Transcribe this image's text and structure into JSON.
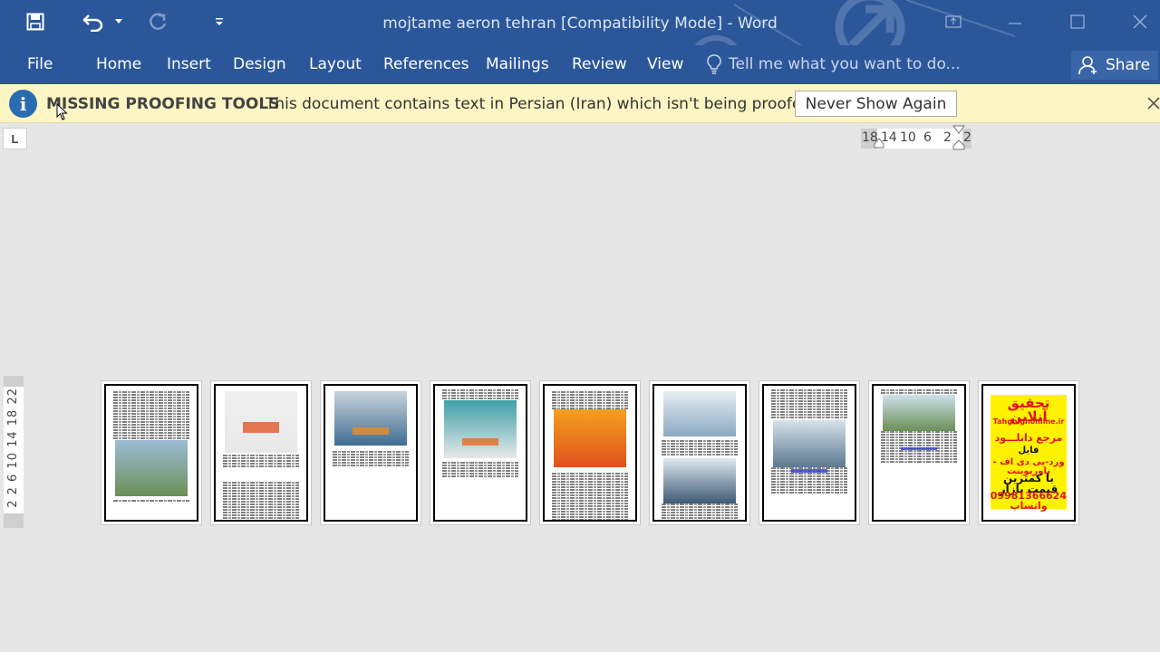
{
  "window": {
    "title": "mojtame aeron tehran [Compatibility Mode] - Word"
  },
  "ribbon": {
    "tabs": [
      "File",
      "Home",
      "Insert",
      "Design",
      "Layout",
      "References",
      "Mailings",
      "Review",
      "View"
    ],
    "tell_me_placeholder": "Tell me what you want to do...",
    "share_label": "Share"
  },
  "message_bar": {
    "title": "MISSING PROOFING TOOLS",
    "text": "This document contains text in Persian (Iran) which isn't being proofed.",
    "button_label": "Never Show Again"
  },
  "ruler": {
    "tab_selector": "L",
    "horizontal_numbers": [
      "18",
      "14",
      "10",
      "6",
      "2",
      "2"
    ],
    "vertical_text": "2 2 6 10 14 18 22"
  },
  "pages": {
    "count": 9,
    "last_page_ad": {
      "line1": "تحقیق آنلاین",
      "line2": "Tahghighonline.ir",
      "line3": "مرجع دانلـــود",
      "line4": "فایل",
      "line5": "ورد-پی دی اف - پاورپوینت",
      "line6": "با کمترین قیمت بازار",
      "line7": "09981366624 واتساپ"
    }
  },
  "colors": {
    "word_blue": "#2b579a",
    "message_bar_bg": "#fdf5c4",
    "ad_yellow": "#fff200",
    "ad_red": "#e0141c"
  },
  "icons": [
    "save-icon",
    "undo-icon",
    "redo-icon",
    "customize-qat-icon",
    "ribbon-display-icon",
    "minimize-icon",
    "maximize-icon",
    "close-icon",
    "lightbulb-icon",
    "person-icon",
    "info-icon"
  ]
}
